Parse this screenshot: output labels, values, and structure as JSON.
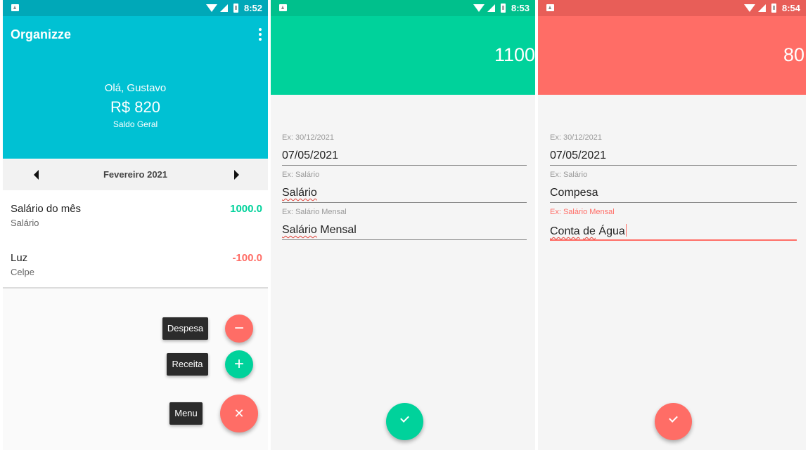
{
  "colors": {
    "primary": "#00c1d3",
    "primary_dark": "#00a8b8",
    "income": "#00d29b",
    "income_dark": "#00c08c",
    "expense": "#ff6d66",
    "expense_dark": "#e85e58"
  },
  "screen1": {
    "time": "8:52",
    "app_title": "Organizze",
    "greeting": "Olá, Gustavo",
    "balance": "R$ 820",
    "balance_label": "Saldo Geral",
    "month": "Fevereiro 2021",
    "transactions": [
      {
        "title": "Salário do mês",
        "category": "Salário",
        "amount": "1000.0",
        "type": "income"
      },
      {
        "title": "Luz",
        "category": "Celpe",
        "amount": "-100.0",
        "type": "expense"
      }
    ],
    "fab_menu": {
      "expense_label": "Despesa",
      "income_label": "Receita",
      "menu_label": "Menu",
      "expense_icon": "minus-icon",
      "income_icon": "plus-icon",
      "close_icon": "close-icon"
    }
  },
  "screen2": {
    "time": "8:53",
    "value": "1100",
    "fields": [
      {
        "hint": "Ex: 30/12/2021",
        "value": "07/05/2021"
      },
      {
        "hint": "Ex: Salário",
        "value": "Salário"
      },
      {
        "hint": "Ex: Salário Mensal",
        "value_part1": "Salário",
        "value_part2": " Mensal"
      }
    ],
    "confirm_icon": "check-icon"
  },
  "screen3": {
    "time": "8:54",
    "value": "80",
    "fields": [
      {
        "hint": "Ex: 30/12/2021",
        "value": "07/05/2021"
      },
      {
        "hint": "Ex: Salário",
        "value": "Compesa"
      },
      {
        "hint": "Ex: Salário Mensal",
        "value_part1": "Conta",
        "value_part2": " ",
        "value_part3": "de",
        "value_part4": " ",
        "value_part5": "Água"
      }
    ],
    "confirm_icon": "check-icon"
  }
}
